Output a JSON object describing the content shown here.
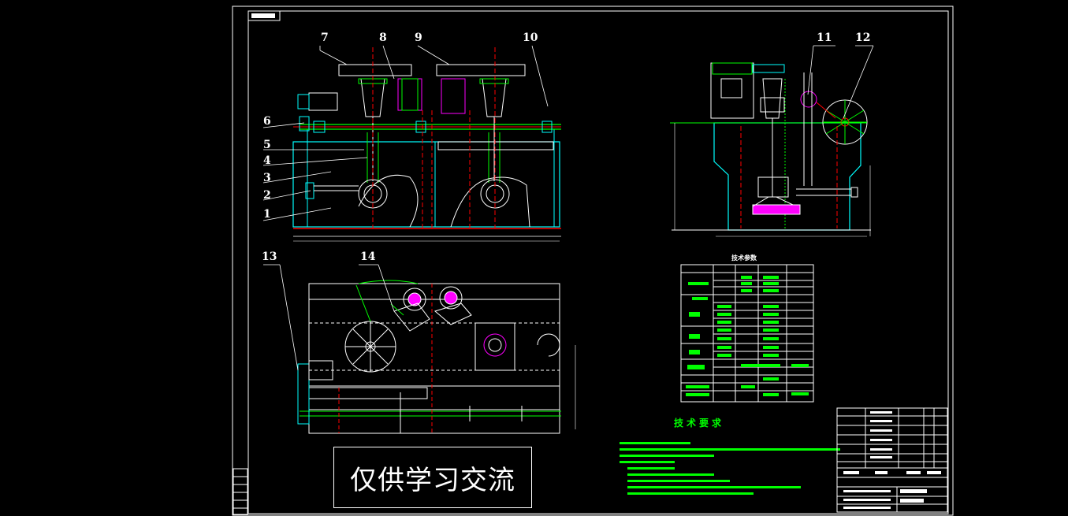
{
  "drawing": {
    "callouts": [
      "1",
      "2",
      "3",
      "4",
      "5",
      "6",
      "7",
      "8",
      "9",
      "10",
      "11",
      "12",
      "13",
      "14"
    ],
    "tech_requirements_title": "技术要求",
    "params_table_title": "技术参数",
    "watermark": "仅供学习交流"
  },
  "colors": {
    "background": "#000000",
    "frame": "#ffffff",
    "outline_green": "#00ff00",
    "tank_cyan": "#00ffff",
    "center_red": "#ff0000",
    "accent_magenta": "#ff00ff",
    "dim_yellow": "#ffff00"
  }
}
